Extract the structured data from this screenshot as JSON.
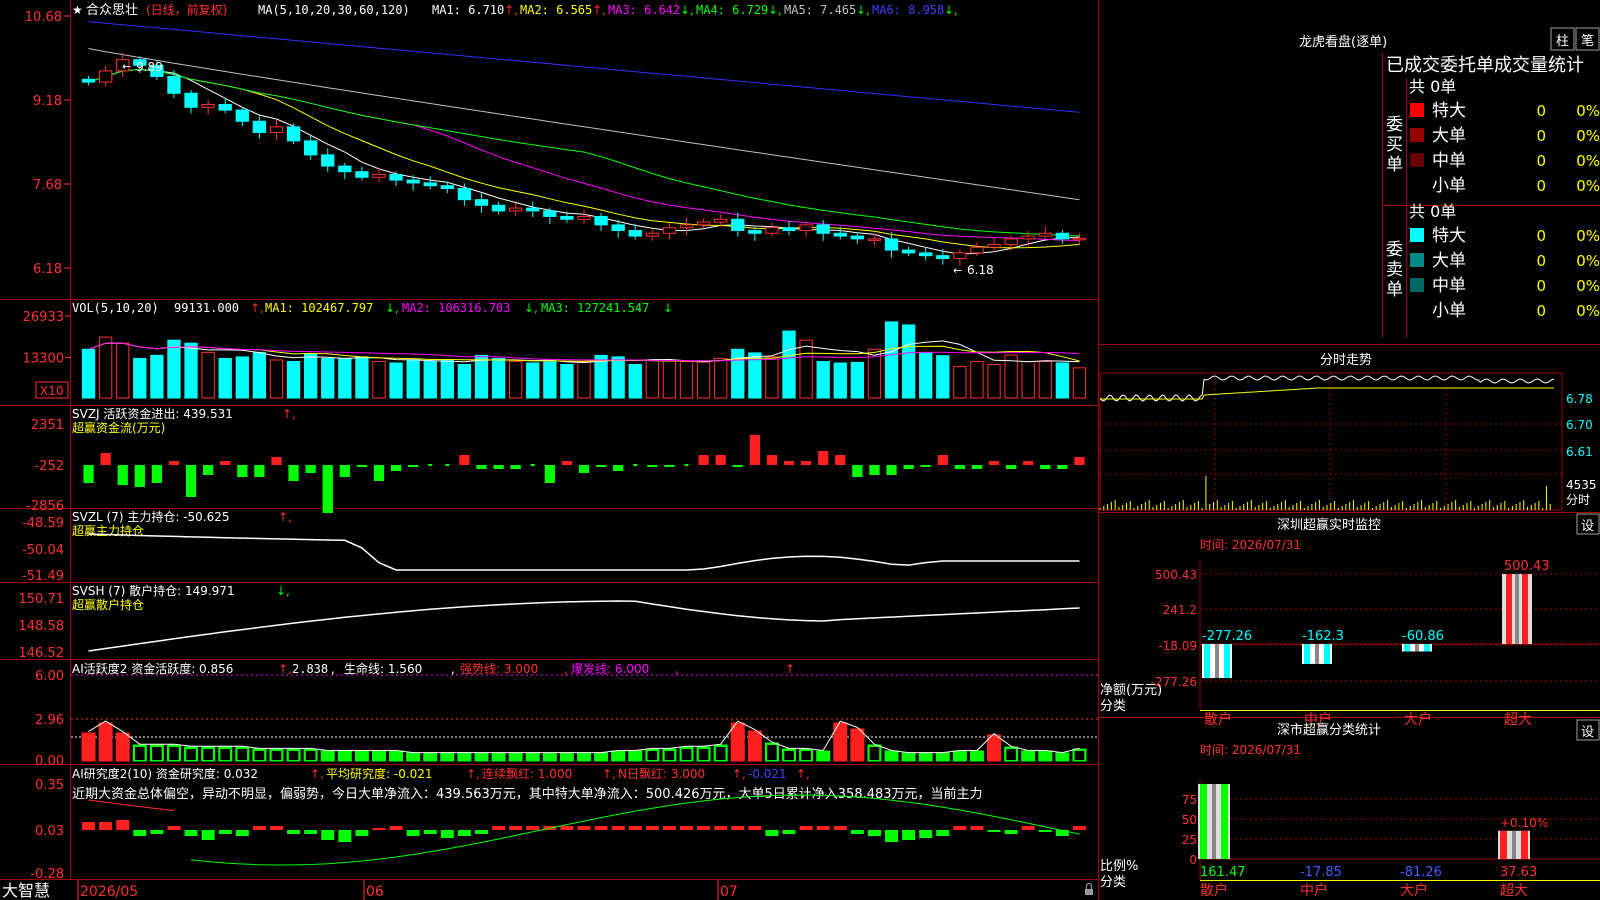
{
  "main": {
    "title_star": "★",
    "title": "合众思壮",
    "title_mode": "(日线，前复权)",
    "ma_prefix": "MA(5,10,20,30,60,120)",
    "ma_labels": [
      {
        "label": "MA1: 6.710",
        "arrow": "↑",
        "color": "#ffffff"
      },
      {
        "label": "MA2: 6.565",
        "arrow": "↑",
        "color": "#ffff00"
      },
      {
        "label": "MA3: 6.642",
        "arrow": "↓",
        "color": "#ff00ff"
      },
      {
        "label": "MA4: 6.729",
        "arrow": "↓",
        "color": "#00ff00"
      },
      {
        "label": "MA5: 7.465",
        "arrow": "↓",
        "color": "#c0c0c0"
      },
      {
        "label": "MA6: 8.958",
        "arrow": "↓",
        "color": "#4040ff"
      }
    ],
    "y_ticks": [
      "10.68",
      "9.18",
      "7.68",
      "6.18"
    ],
    "high_label": "9.89",
    "low_label": "6.18"
  },
  "vol": {
    "label": "VOL(5,10,20)",
    "value": "99131.000",
    "ma1": "MA1: 102467.797",
    "ma2": "MA2: 106316.703",
    "ma3": "MA3: 127241.547",
    "y_ticks": [
      "26933",
      "13300"
    ],
    "unit_badge": "X10"
  },
  "svzj": {
    "label": "SVZJ  活跃资金进出: 439.531",
    "sub": "超赢资金流(万元)",
    "y_ticks": [
      "2351",
      "-252",
      "-2856"
    ]
  },
  "svzl": {
    "label": "SVZL (7) 主力持仓: -50.625",
    "sub": "超赢主力持仓",
    "y_ticks": [
      "-48.59",
      "-50.04",
      "-51.49"
    ]
  },
  "svsh": {
    "label": "SVSH (7) 散户持仓: 149.971",
    "sub": "超赢散户持仓",
    "y_ticks": [
      "150.71",
      "148.58",
      "146.52"
    ]
  },
  "ai2": {
    "label": "AI活跃度2 资金活跃度: 0.856",
    "v2": "2.838",
    "life": "生命线: 1.560",
    "strong": "强势线: 3.000",
    "burst": "爆发线: 6.000",
    "y_ticks": [
      "6.00",
      "2.96",
      "0.00"
    ]
  },
  "ai_res": {
    "label": "AI研究度2(10) 资金研究度: 0.032",
    "avg": "平均研究度: -0.021",
    "cont": "连续飘红: 1.000",
    "nday": "N日飘红: 3.000",
    "last": "-0.021",
    "y_ticks": [
      "0.35",
      "0.03",
      "-0.28"
    ],
    "comment": "近期大资金总体偏空，异动不明显，偏弱势，今日大单净流入：439.563万元，其中特大单净流入：500.426万元，大单5日累计净入358.483万元，当前主力"
  },
  "xaxis": {
    "brand": "大智慧",
    "dates": [
      "2026/05",
      "06",
      "07"
    ]
  },
  "right": {
    "lhb_title": "龙虎看盘(逐单)",
    "tab_zhu": "柱",
    "tab_bi": "笔",
    "stat_title": "已成交委托单成交量统计",
    "buy": {
      "label_chars": [
        "委",
        "买",
        "单"
      ],
      "total": "共 0单",
      "rows": [
        {
          "name": "特大",
          "val": "0",
          "pct": "0%",
          "color": "#ff0000"
        },
        {
          "name": "大单",
          "val": "0",
          "pct": "0%",
          "color": "#990000"
        },
        {
          "name": "中单",
          "val": "0",
          "pct": "0%",
          "color": "#660000"
        },
        {
          "name": "小单",
          "val": "0",
          "pct": "0%",
          "color": "#000000"
        }
      ]
    },
    "sell": {
      "label_chars": [
        "委",
        "卖",
        "单"
      ],
      "total": "共 0单",
      "rows": [
        {
          "name": "特大",
          "val": "0",
          "pct": "0%",
          "color": "#00ffff"
        },
        {
          "name": "大单",
          "val": "0",
          "pct": "0%",
          "color": "#008888"
        },
        {
          "name": "中单",
          "val": "0",
          "pct": "0%",
          "color": "#006666"
        },
        {
          "name": "小单",
          "val": "0",
          "pct": "0%",
          "color": "#000000"
        }
      ]
    },
    "fenshi_title": "分时走势",
    "fenshi_ticks": [
      "6.78",
      "6.70",
      "6.61"
    ],
    "fenshi_vol": "4535",
    "fenshi_vol_label": "分时",
    "monitor_title": "深圳超赢实时监控",
    "monitor_settings": "设",
    "monitor_time": "时间: 2026/07/31",
    "monitor_ticks": [
      "500.43",
      "241.2",
      "-18.09",
      "-277.26"
    ],
    "monitor_axis_title": "净额(万元)",
    "monitor_axis_cat": "分类",
    "monitor_bars": [
      {
        "cat": "散户",
        "value": -277.26,
        "label": "-277.26"
      },
      {
        "cat": "中户",
        "value": -162.3,
        "label": "-162.3"
      },
      {
        "cat": "大户",
        "value": -60.86,
        "label": "-60.86"
      },
      {
        "cat": "超大",
        "value": 500.43,
        "label": "500.43"
      }
    ],
    "class_title": "深市超赢分类统计",
    "class_settings": "设",
    "class_time": "时间: 2026/07/31",
    "class_ticks": [
      "75",
      "50",
      "25",
      "0"
    ],
    "class_axis_title": "比例%",
    "class_axis_cat": "分类",
    "class_bars": [
      {
        "cat": "散户",
        "value": 161.47,
        "label": "161.47"
      },
      {
        "cat": "中户",
        "value": -17.85,
        "label": "-17.85"
      },
      {
        "cat": "大户",
        "value": -81.26,
        "label": "-81.26"
      },
      {
        "cat": "超大",
        "value": 37.63,
        "label": "37.63",
        "top_label": "+0.10%"
      }
    ]
  },
  "chart_data": {
    "type": "candlestick",
    "x_ticks": [
      "2026/05",
      "06",
      "07"
    ],
    "ylim": [
      6.18,
      10.68
    ],
    "close": [
      9.5,
      9.7,
      9.9,
      9.8,
      9.6,
      9.3,
      9.05,
      9.1,
      9.0,
      8.8,
      8.6,
      8.7,
      8.45,
      8.2,
      8.0,
      7.9,
      7.8,
      7.85,
      7.75,
      7.7,
      7.65,
      7.6,
      7.4,
      7.3,
      7.2,
      7.25,
      7.2,
      7.1,
      7.05,
      7.1,
      6.95,
      6.85,
      6.75,
      6.8,
      6.9,
      6.95,
      7.0,
      7.05,
      6.85,
      6.8,
      6.9,
      6.85,
      6.95,
      6.8,
      6.75,
      6.7,
      6.7,
      6.5,
      6.45,
      6.4,
      6.35,
      6.45,
      6.55,
      6.6,
      6.7,
      6.75,
      6.8,
      6.7,
      6.71
    ],
    "volume": [
      16000,
      20000,
      18000,
      13000,
      14000,
      19000,
      18000,
      15000,
      13000,
      13500,
      15000,
      12500,
      12000,
      14500,
      13000,
      13000,
      13500,
      12000,
      11500,
      12500,
      12000,
      12500,
      11000,
      14000,
      13000,
      12000,
      11500,
      11800,
      11000,
      12000,
      14000,
      13500,
      11000,
      12500,
      12300,
      12000,
      11800,
      13000,
      16000,
      14800,
      13500,
      22000,
      19000,
      12000,
      11500,
      11700,
      16000,
      25000,
      24000,
      14800,
      13900,
      10300,
      12000,
      11000,
      14100,
      12000,
      12000,
      11500,
      9900
    ]
  }
}
